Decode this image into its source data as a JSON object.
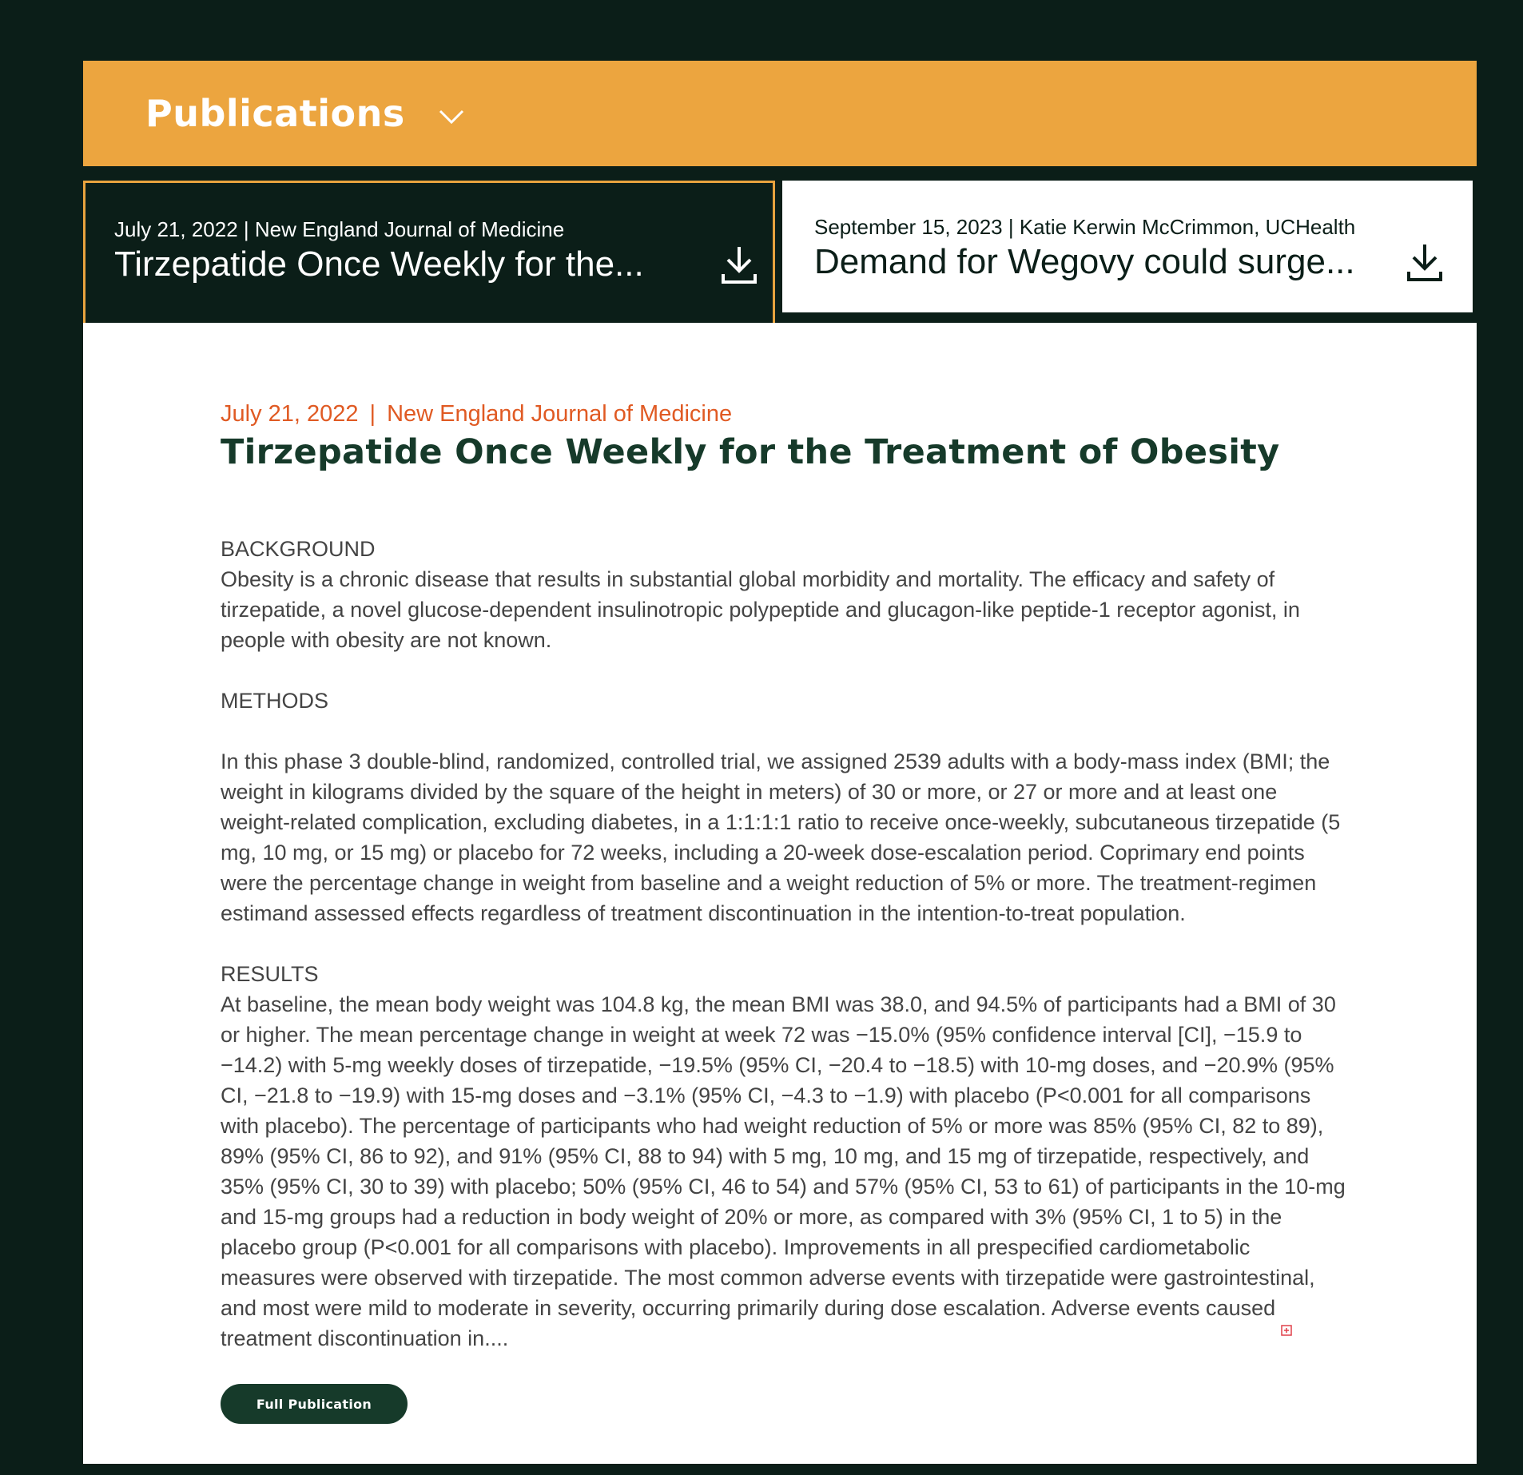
{
  "header": {
    "title": "Publications",
    "chevron_icon": "chevron-down-icon"
  },
  "cards": [
    {
      "meta": "July 21, 2022 | New England Journal of Medicine",
      "title": "Tirzepatide Once Weekly for the...",
      "icon": "download-icon",
      "active": true
    },
    {
      "meta": "September 15, 2023 | Katie Kerwin McCrimmon, UCHealth",
      "title": "Demand for Wegovy could surge...",
      "icon": "download-icon",
      "active": false
    }
  ],
  "article": {
    "date": "July 21, 2022",
    "separator": "|",
    "source": "New England Journal of Medicine",
    "title": "Tirzepatide Once Weekly for the Treatment of Obesity",
    "background_heading": "BACKGROUND",
    "background_text": "Obesity is a chronic disease that results in substantial global morbidity and mortality. The efficacy and safety of tirzepatide, a novel glucose-dependent insulinotropic polypeptide and glucagon-like peptide-1 receptor agonist, in people with obesity are not known.",
    "methods_heading": "METHODS",
    "methods_text": "In this phase 3 double-blind, randomized, controlled trial, we assigned 2539 adults with a body-mass index (BMI; the weight in kilograms divided by the square of the height in meters) of 30 or more, or 27 or more and at least one weight-related complication, excluding diabetes, in a 1:1:1:1 ratio to receive once-weekly, subcutaneous tirzepatide (5 mg, 10 mg, or 15 mg) or placebo for 72 weeks, including a 20-week dose-escalation period. Coprimary end points were the percentage change in weight from baseline and a weight reduction of 5% or more. The treatment-regimen estimand assessed effects regardless of treatment discontinuation in the intention-to-treat population.",
    "results_heading": "RESULTS",
    "results_text": "At baseline, the mean body weight was 104.8 kg, the mean BMI was 38.0, and 94.5% of participants had a BMI of 30 or higher. The mean percentage change in weight at week 72 was −15.0% (95% confidence interval [CI], −15.9 to −14.2) with 5-mg weekly doses of tirzepatide, −19.5% (95% CI, −20.4 to −18.5) with 10-mg doses, and −20.9% (95% CI, −21.8 to −19.9) with 15-mg doses and −3.1% (95% CI, −4.3 to −1.9) with placebo (P<0.001 for all comparisons with placebo). The percentage of participants who had weight reduction of 5% or more was 85% (95% CI, 82 to 89), 89% (95% CI, 86 to 92), and 91% (95% CI, 88 to 94) with 5 mg, 10 mg, and 15 mg of tirzepatide, respectively, and 35% (95% CI, 30 to 39) with placebo; 50% (95% CI, 46 to 54) and 57% (95% CI, 53 to 61) of participants in the 10-mg and 15-mg groups had a reduction in body weight of 20% or more, as compared with 3% (95% CI, 1 to 5) in the placebo group (P<0.001 for all comparisons with placebo). Improvements in all prespecified cardiometabolic measures were observed with tirzepatide. The most common adverse events with tirzepatide were gastrointestinal, and most were mild to moderate in severity, occurring primarily during dose escalation. Adverse events caused treatment discontinuation in....",
    "expand_icon": "expand-icon",
    "full_publication_label": "Full Publication"
  },
  "colors": {
    "page_background": "#0b1e18",
    "header_accent": "#eca53f",
    "card_active_border": "#e8a33e",
    "meta_orange": "#e05a23",
    "title_green": "#163a2a",
    "body_text": "#444444",
    "button_bg": "#163a2a"
  }
}
